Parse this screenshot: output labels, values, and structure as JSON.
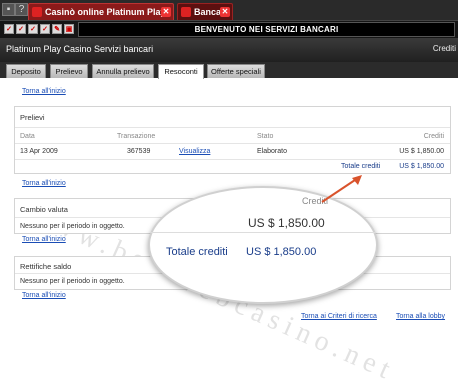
{
  "browser": {
    "tabs": [
      {
        "label": "Casinò online Platinum Play"
      },
      {
        "label": "Banca"
      }
    ],
    "help_glyph": "?",
    "close_glyph": "✕"
  },
  "toolbar": {
    "welcome": "BENVENUTO NEI SERVIZI BANCARI"
  },
  "header": {
    "title": "Platinum Play Casino Servizi bancari",
    "right_label": "Crediti"
  },
  "nav_tabs": [
    {
      "label": "Deposito"
    },
    {
      "label": "Prelievo"
    },
    {
      "label": "Annulla prelievo"
    },
    {
      "label": "Resoconti"
    },
    {
      "label": "Offerte speciali"
    }
  ],
  "top_link": "Torna all'inizio",
  "prelievi": {
    "title": "Prelievi",
    "columns": [
      "Data",
      "Transazione",
      "Stato",
      "Crediti"
    ],
    "rows": [
      {
        "date": "13 Apr 2009",
        "transaction": "367539",
        "action": "Visualizza",
        "status": "Elaborato",
        "credits": "US $ 1,850.00"
      }
    ],
    "total_label": "Totale crediti",
    "total_value": "US $ 1,850.00",
    "back_link": "Torna all'inizio"
  },
  "cambio": {
    "title": "Cambio valuta",
    "empty": "Nessuno per il periodo in oggetto.",
    "back_link": "Torna all'inizio"
  },
  "rettifiche": {
    "title": "Rettifiche saldo",
    "empty": "Nessuno per il periodo in oggetto.",
    "back_link": "Torna all'inizio"
  },
  "footer": {
    "criteria_link": "Torna ai Criteri di ricerca",
    "lobby_link": "Torna alla lobby"
  },
  "zoom": {
    "credits_label": "Crediti",
    "credits_value": "US $ 1,850.00",
    "total_label": "Totale crediti",
    "total_value": "US $ 1,850.00"
  },
  "watermark": "www.bestwebcasino.net",
  "colors": {
    "accent_tab": "#8b1a1a",
    "link": "#1a4db5",
    "arrow": "#d9532c"
  }
}
